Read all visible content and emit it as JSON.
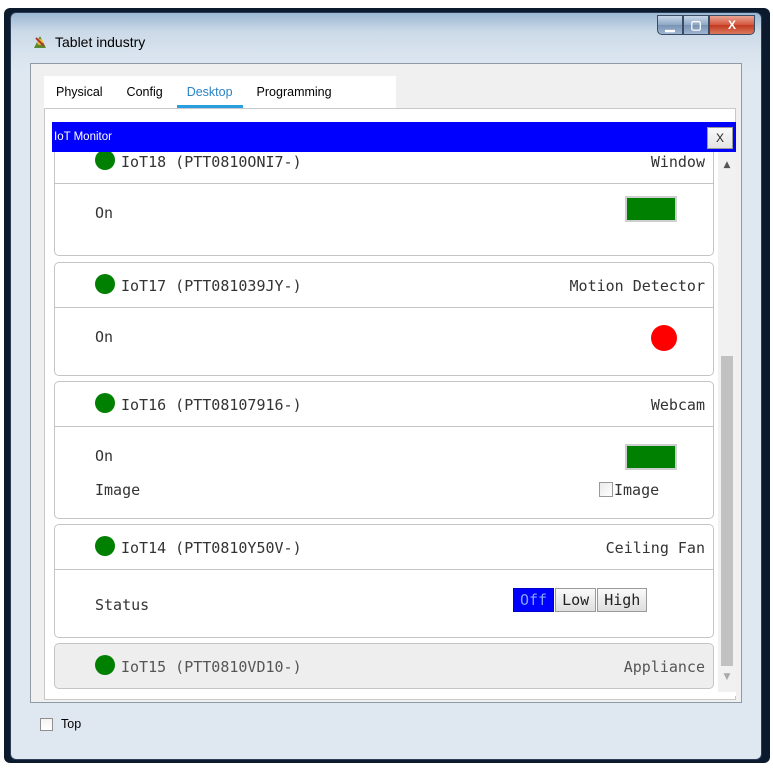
{
  "window": {
    "title": "Tablet industry",
    "minimize_glyph": "▁",
    "maximize_glyph": "▢",
    "close_glyph": "X"
  },
  "tabs": [
    {
      "label": "Physical",
      "active": false
    },
    {
      "label": "Config",
      "active": false
    },
    {
      "label": "Desktop",
      "active": true
    },
    {
      "label": "Programming",
      "active": false
    }
  ],
  "monitor": {
    "title": "IoT Monitor",
    "close_label": "X"
  },
  "devices": [
    {
      "name": "IoT18 (PTT0810ONI7-)",
      "type": "Window",
      "status_color": "#008000",
      "rows": [
        {
          "label": "On",
          "indicator": "green-box"
        }
      ]
    },
    {
      "name": "IoT17 (PTT081039JY-)",
      "type": "Motion Detector",
      "status_color": "#008000",
      "rows": [
        {
          "label": "On",
          "indicator": "red-dot"
        }
      ]
    },
    {
      "name": "IoT16 (PTT08107916-)",
      "type": "Webcam",
      "status_color": "#008000",
      "rows": [
        {
          "label": "On",
          "indicator": "green-box"
        },
        {
          "label": "Image",
          "value": "Image"
        }
      ]
    },
    {
      "name": "IoT14 (PTT0810Y50V-)",
      "type": "Ceiling Fan",
      "status_color": "#008000",
      "rows": [
        {
          "label": "Status",
          "options": [
            "Off",
            "Low",
            "High"
          ],
          "selected": "Off"
        }
      ]
    },
    {
      "name": "IoT15 (PTT0810VD10-)",
      "type": "Appliance",
      "status_color": "#008000"
    }
  ],
  "footer": {
    "top_label": "Top",
    "top_checked": false
  },
  "colors": {
    "monitor_header": "#0000ff",
    "on_green": "#008000",
    "motion_red": "#ff0000",
    "tab_active": "#2a85c6"
  }
}
